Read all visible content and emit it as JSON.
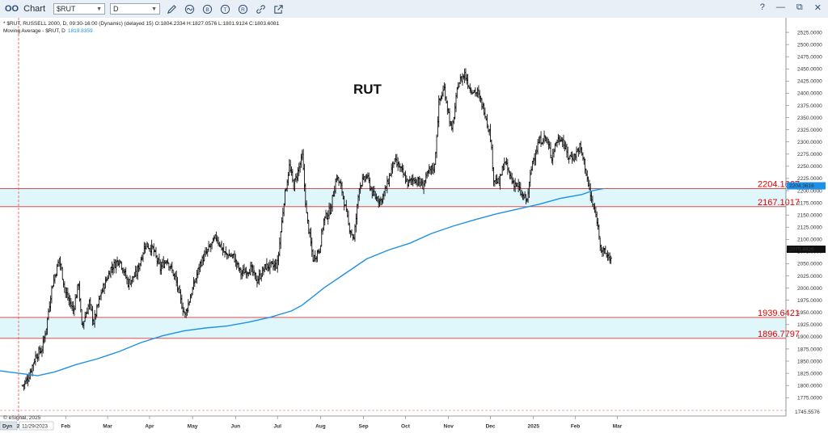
{
  "toolbar": {
    "window_title": "Chart",
    "symbol_value": "$RUT",
    "interval_value": "D",
    "help_label": "?",
    "minimize_label": "—",
    "restore_label": "⧉",
    "close_label": "✕",
    "icons": [
      "pencil-icon",
      "wave-icon",
      "b-circle-icon",
      "t-circle-icon",
      "r-circle-icon",
      "link-icon",
      "external-link-icon"
    ]
  },
  "chart_data": {
    "type": "ohlc",
    "title": "RUT",
    "header_line": "* $RUT, RUSSELL 2000, D, 09:30-16:00 (Dynamic) (delayed 15) O:1804.2334 H:1827.0576 L:1801.9124 C:1803.6081",
    "ma_label": "Moving Average - $RUT, D",
    "ma_value": "1819.8359",
    "last_price_label": "2075.4826",
    "ma_axis_label": "2204.3616",
    "axis_bottom_value": "1745.5576",
    "date_box": "11/29/2023",
    "timeframe_box": "Dyn",
    "watermark": "© eSignal, 2025",
    "ylim": [
      1745.5576,
      2540
    ],
    "y_ticks": [
      1775,
      1800,
      1825,
      1850,
      1875,
      1900,
      1925,
      1950,
      1975,
      2000,
      2025,
      2050,
      2075,
      2100,
      2125,
      2150,
      2175,
      2200,
      2225,
      2250,
      2275,
      2300,
      2325,
      2350,
      2375,
      2400,
      2425,
      2450,
      2475,
      2500,
      2525
    ],
    "x_months": [
      {
        "label": "2024",
        "bar": 0
      },
      {
        "label": "Feb",
        "bar": 40
      },
      {
        "label": "Mar",
        "bar": 79
      },
      {
        "label": "Apr",
        "bar": 118
      },
      {
        "label": "May",
        "bar": 158
      },
      {
        "label": "Jun",
        "bar": 198
      },
      {
        "label": "Jul",
        "bar": 237
      },
      {
        "label": "Aug",
        "bar": 277
      },
      {
        "label": "Sep",
        "bar": 317
      },
      {
        "label": "Oct",
        "bar": 356
      },
      {
        "label": "Nov",
        "bar": 396
      },
      {
        "label": "Dec",
        "bar": 435
      },
      {
        "label": "2025",
        "bar": 475
      },
      {
        "label": "Feb",
        "bar": 514
      },
      {
        "label": "Mar",
        "bar": 553
      }
    ],
    "levels": [
      {
        "value": 2204.1667,
        "label": "2204.1667"
      },
      {
        "value": 2167.1017,
        "label": "2167.1017"
      },
      {
        "value": 1939.6421,
        "label": "1939.6421"
      },
      {
        "value": 1896.7797,
        "label": "1896.7797"
      }
    ],
    "zones": [
      {
        "from": 2167.1017,
        "to": 2204.1667
      },
      {
        "from": 1896.7797,
        "to": 1939.6421
      }
    ],
    "anchors": [
      [
        0,
        1800
      ],
      [
        5,
        1815
      ],
      [
        12,
        1860
      ],
      [
        18,
        1875
      ],
      [
        22,
        1920
      ],
      [
        27,
        2000
      ],
      [
        34,
        2060
      ],
      [
        40,
        1990
      ],
      [
        47,
        1955
      ],
      [
        52,
        2010
      ],
      [
        55,
        1920
      ],
      [
        62,
        1970
      ],
      [
        66,
        1930
      ],
      [
        73,
        1990
      ],
      [
        82,
        2040
      ],
      [
        90,
        2060
      ],
      [
        98,
        2010
      ],
      [
        106,
        2030
      ],
      [
        114,
        2090
      ],
      [
        121,
        2080
      ],
      [
        128,
        2040
      ],
      [
        134,
        2060
      ],
      [
        142,
        2020
      ],
      [
        148,
        1965
      ],
      [
        151,
        1945
      ],
      [
        157,
        1990
      ],
      [
        165,
        2050
      ],
      [
        173,
        2080
      ],
      [
        180,
        2105
      ],
      [
        188,
        2070
      ],
      [
        196,
        2065
      ],
      [
        203,
        2030
      ],
      [
        212,
        2040
      ],
      [
        218,
        2015
      ],
      [
        226,
        2045
      ],
      [
        234,
        2045
      ],
      [
        237,
        2050
      ],
      [
        243,
        2180
      ],
      [
        248,
        2250
      ],
      [
        252,
        2210
      ],
      [
        256,
        2240
      ],
      [
        260,
        2270
      ],
      [
        264,
        2150
      ],
      [
        270,
        2060
      ],
      [
        276,
        2080
      ],
      [
        280,
        2140
      ],
      [
        286,
        2160
      ],
      [
        292,
        2230
      ],
      [
        297,
        2200
      ],
      [
        303,
        2130
      ],
      [
        308,
        2100
      ],
      [
        313,
        2210
      ],
      [
        320,
        2230
      ],
      [
        326,
        2190
      ],
      [
        333,
        2180
      ],
      [
        338,
        2205
      ],
      [
        345,
        2260
      ],
      [
        350,
        2250
      ],
      [
        358,
        2215
      ],
      [
        364,
        2225
      ],
      [
        372,
        2210
      ],
      [
        378,
        2240
      ],
      [
        383,
        2250
      ],
      [
        387,
        2380
      ],
      [
        392,
        2410
      ],
      [
        399,
        2320
      ],
      [
        405,
        2420
      ],
      [
        411,
        2440
      ],
      [
        416,
        2410
      ],
      [
        423,
        2400
      ],
      [
        430,
        2360
      ],
      [
        435,
        2310
      ],
      [
        438,
        2225
      ],
      [
        443,
        2215
      ],
      [
        448,
        2260
      ],
      [
        455,
        2220
      ],
      [
        460,
        2210
      ],
      [
        464,
        2190
      ],
      [
        469,
        2180
      ],
      [
        474,
        2260
      ],
      [
        480,
        2300
      ],
      [
        486,
        2310
      ],
      [
        492,
        2270
      ],
      [
        496,
        2300
      ],
      [
        501,
        2310
      ],
      [
        507,
        2270
      ],
      [
        513,
        2270
      ],
      [
        518,
        2290
      ],
      [
        522,
        2260
      ],
      [
        527,
        2200
      ],
      [
        530,
        2170
      ],
      [
        534,
        2140
      ],
      [
        538,
        2080
      ],
      [
        542,
        2070
      ],
      [
        547,
        2060
      ]
    ],
    "ma_points": [
      [
        0,
        1830
      ],
      [
        14,
        1820
      ],
      [
        30,
        1828
      ],
      [
        50,
        1843
      ],
      [
        70,
        1855
      ],
      [
        90,
        1870
      ],
      [
        110,
        1888
      ],
      [
        130,
        1902
      ],
      [
        150,
        1912
      ],
      [
        170,
        1918
      ],
      [
        190,
        1922
      ],
      [
        210,
        1930
      ],
      [
        230,
        1940
      ],
      [
        250,
        1953
      ],
      [
        260,
        1965
      ],
      [
        280,
        2000
      ],
      [
        300,
        2030
      ],
      [
        320,
        2060
      ],
      [
        340,
        2078
      ],
      [
        360,
        2092
      ],
      [
        380,
        2112
      ],
      [
        400,
        2127
      ],
      [
        420,
        2140
      ],
      [
        440,
        2152
      ],
      [
        460,
        2162
      ],
      [
        480,
        2172
      ],
      [
        500,
        2184
      ],
      [
        520,
        2192
      ],
      [
        530,
        2200
      ],
      [
        540,
        2204.36
      ]
    ]
  }
}
